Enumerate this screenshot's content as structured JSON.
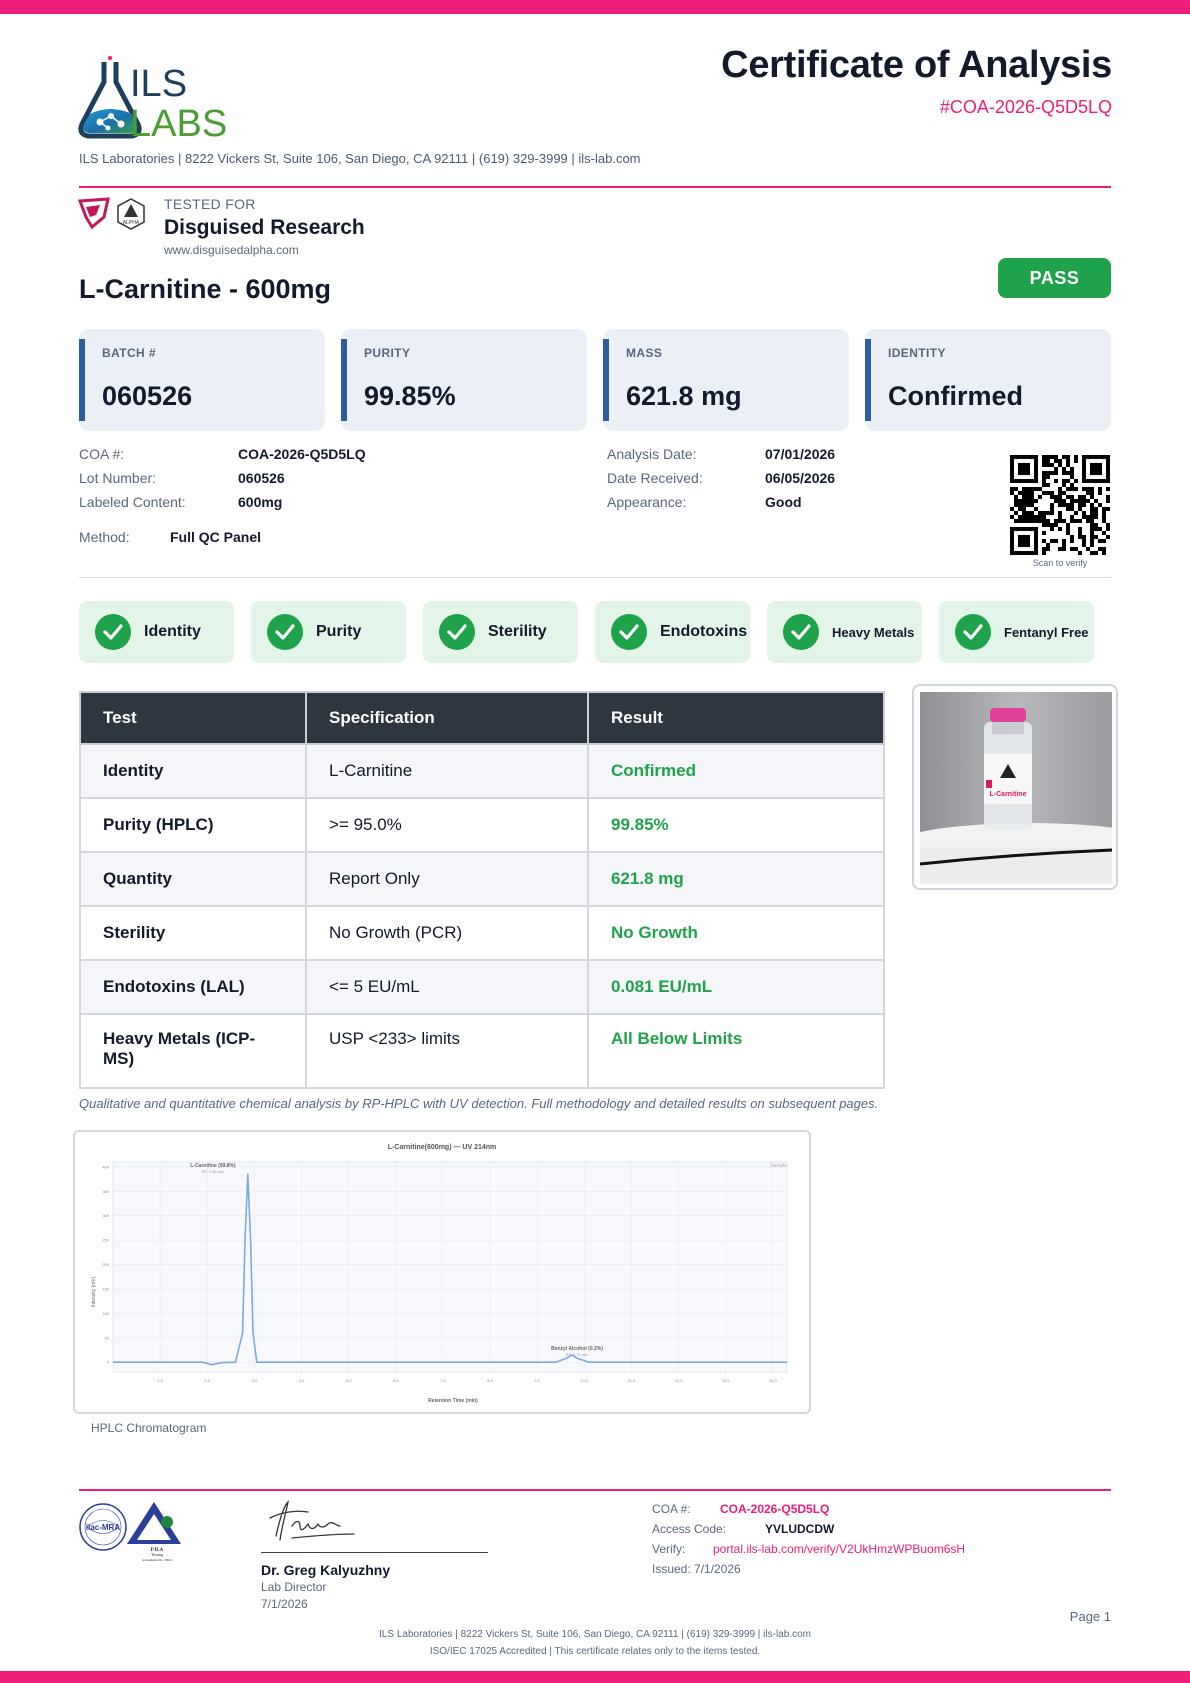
{
  "header": {
    "logo": {
      "line1": "ILS",
      "line2": "LABS"
    },
    "title": "Certificate of Analysis",
    "coa_id": "#COA-2026-Q5D5LQ",
    "lab_line": "ILS Laboratories  |  8222 Vickers St, Suite 106, San Diego, CA 92111  |  (619) 329-3999  |  ils-lab.com"
  },
  "client": {
    "tested_for_label": "TESTED FOR",
    "name": "Disguised Research",
    "website": "www.disguisedalpha.com",
    "logo_text": "ALPHA"
  },
  "product": {
    "name": "L-Carnitine - 600mg",
    "status": "PASS"
  },
  "stats": [
    {
      "label": "BATCH #",
      "value": "060526"
    },
    {
      "label": "PURITY",
      "value": "99.85%"
    },
    {
      "label": "MASS",
      "value": "621.8 mg"
    },
    {
      "label": "IDENTITY",
      "value": "Confirmed"
    }
  ],
  "info": {
    "coa_label": "COA #:",
    "coa_value": "COA-2026-Q5D5LQ",
    "lot_label": "Lot Number:",
    "lot_value": "060526",
    "labeled_label": "Labeled Content:",
    "labeled_value": "600mg",
    "method_label": "Method:",
    "method_value": "Full QC Panel",
    "analysis_label": "Analysis Date:",
    "analysis_value": "07/01/2026",
    "received_label": "Date Received:",
    "received_value": "06/05/2026",
    "appearance_label": "Appearance:",
    "appearance_value": "Good",
    "qr_caption": "Scan to verify"
  },
  "checks": [
    "Identity",
    "Purity",
    "Sterility",
    "Endotoxins",
    "Heavy Metals",
    "Fentanyl Free"
  ],
  "table": {
    "headers": [
      "Test",
      "Specification",
      "Result"
    ],
    "rows": [
      {
        "test": "Identity",
        "spec": "L-Carnitine",
        "result": "Confirmed"
      },
      {
        "test": "Purity (HPLC)",
        "spec": ">= 95.0%",
        "result": "99.85%"
      },
      {
        "test": "Quantity",
        "spec": "Report Only",
        "result": "621.8 mg"
      },
      {
        "test": "Sterility",
        "spec": "No Growth (PCR)",
        "result": "No Growth"
      },
      {
        "test": "Endotoxins (LAL)",
        "spec": "<= 5 EU/mL",
        "result": "0.081 EU/mL"
      },
      {
        "test": "Heavy Metals (ICP-MS)",
        "spec": "USP <233> limits",
        "result": "All Below Limits"
      }
    ]
  },
  "vial": {
    "label_text": "L-Carnitine"
  },
  "method_note": "Qualitative and quantitative chemical analysis by RP-HPLC with UV detection. Full methodology and detailed results on subsequent pages.",
  "chromatogram": {
    "title": "L-Carnitine(600mg) — UV 214nm",
    "xlabel": "Retention Time (min)",
    "ylabel": "Intensity (mV)",
    "legend": "Sample",
    "caption": "HPLC Chromatogram",
    "peak1_label": "L-Carnitine (99.8%)",
    "peak1_sub": "RT: 2.86 min",
    "peak2_label": "Benzyl Alcohol (0.2%)",
    "peak2_sub": "RT: 9.73 min",
    "x_ticks": [
      "1.0",
      "2.0",
      "3.0",
      "4.0",
      "5.0",
      "6.0",
      "7.0",
      "8.0",
      "9.0",
      "10.0",
      "11.0",
      "12.0",
      "13.0",
      "14.0"
    ],
    "y_ticks": [
      "0",
      "50",
      "100",
      "150",
      "200",
      "250",
      "300",
      "350",
      "400"
    ]
  },
  "chart_data": {
    "type": "line",
    "title": "L-Carnitine(600mg) — UV 214nm",
    "xlabel": "Retention Time (min)",
    "ylabel": "Intensity (mV)",
    "xlim": [
      0,
      14.3
    ],
    "ylim": [
      -20,
      410
    ],
    "series": [
      {
        "name": "Sample",
        "x": [
          0,
          1.9,
          2.1,
          2.3,
          2.6,
          2.75,
          2.8,
          2.86,
          2.92,
          2.97,
          3.05,
          3.3,
          9.4,
          9.62,
          9.73,
          9.85,
          10.1,
          14.3
        ],
        "y": [
          0,
          0,
          -5,
          -1,
          0,
          60,
          250,
          385,
          250,
          60,
          0,
          0,
          0,
          8,
          15,
          8,
          0,
          0
        ]
      }
    ]
  },
  "footer": {
    "accred_text1": "ilac-MRA",
    "accred_text2": "PJLA",
    "accred_text3": "Testing",
    "accred_text4": "Accreditation No. 59612",
    "signer_name": "Dr. Greg Kalyuzhny",
    "signer_title": "Lab Director",
    "signer_date": "7/1/2026",
    "coa_label": "COA #:",
    "coa_value": "COA-2026-Q5D5LQ",
    "access_label": "Access Code:",
    "access_value": "YVLUDCDW",
    "verify_label": "Verify:",
    "verify_value": "portal.ils-lab.com/verify/V2UkHmzWPBuom6sH",
    "issued": "Issued: 7/1/2026",
    "page": "Page 1",
    "line1": "ILS Laboratories  |  8222 Vickers St, Suite 106, San Diego, CA 92111  |  (619) 329-3999  |  ils-lab.com",
    "line2": "ISO/IEC 17025 Accredited  |  This certificate relates only to the items tested."
  },
  "colors": {
    "accent_pink": "#ec1e79",
    "pass_green": "#1fa34a",
    "header_dark": "#2e3640",
    "stat_accent": "#2c5fa0",
    "trace_blue": "#7fa7e0"
  }
}
